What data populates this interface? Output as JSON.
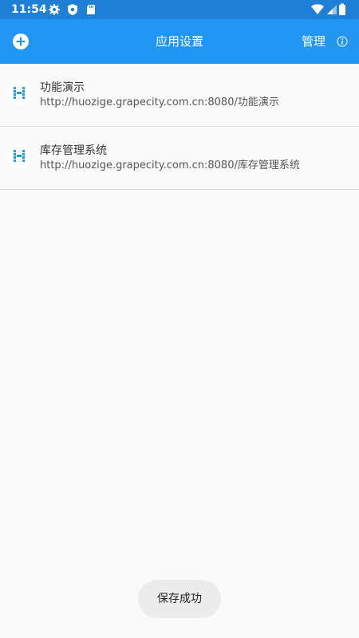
{
  "status_bar": {
    "time": "11:54",
    "left_icons": [
      "gear-icon",
      "shield-icon",
      "sd-card-icon"
    ],
    "right_icons": [
      "wifi-icon",
      "signal-icon",
      "battery-icon"
    ]
  },
  "app_bar": {
    "title": "应用设置",
    "manage_label": "管理",
    "add_icon": "plus-circle-icon",
    "info_icon": "info-icon",
    "color": "#2196f3"
  },
  "apps": [
    {
      "name": "功能演示",
      "url": "http://huozige.grapecity.com.cn:8080/功能演示",
      "icon": "app-logo-icon"
    },
    {
      "name": "库存管理系统",
      "url": "http://huozige.grapecity.com.cn:8080/库存管理系统",
      "icon": "app-logo-icon"
    }
  ],
  "toast": {
    "message": "保存成功"
  },
  "colors": {
    "status_bar": "#1e7fd6",
    "accent": "#2196f3",
    "logo": "#1a9ddb"
  }
}
